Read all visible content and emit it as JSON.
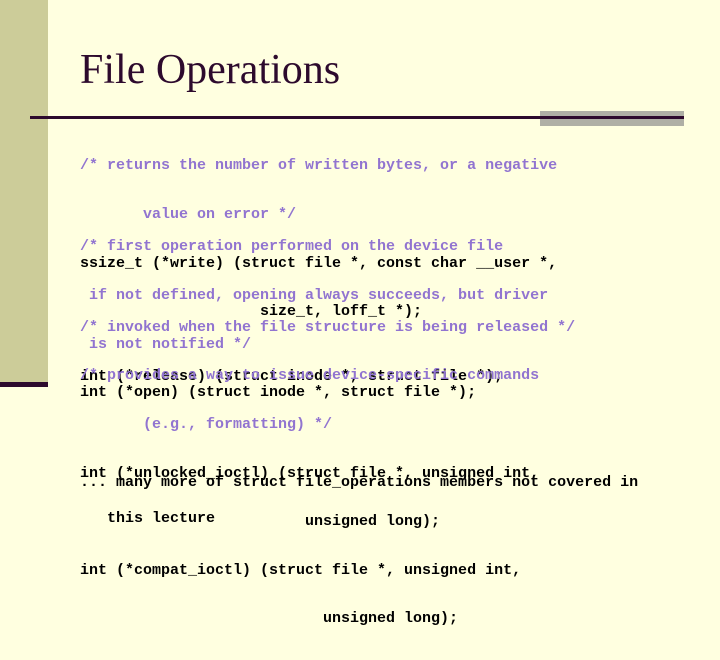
{
  "colors": {
    "background": "#FFFFE0",
    "sidebar": "#CCCC99",
    "accent_dark": "#2D0A2D",
    "rule_gray": "#AFAFA5",
    "comment": "#9174D0",
    "code": "#000000"
  },
  "slide": {
    "title": "File Operations",
    "code_blocks": [
      {
        "lines": [
          {
            "kind": "comment",
            "text": "/* returns the number of written bytes, or a negative"
          },
          {
            "kind": "comment",
            "text": "       value on error */"
          },
          {
            "kind": "code",
            "text": "ssize_t (*write) (struct file *, const char __user *,"
          },
          {
            "kind": "code",
            "text": "                    size_t, loff_t *);"
          }
        ]
      },
      {
        "lines": [
          {
            "kind": "comment",
            "text": "/* first operation performed on the device file"
          },
          {
            "kind": "comment",
            "text": " if not defined, opening always succeeds, but driver"
          },
          {
            "kind": "comment",
            "text": " is not notified */"
          },
          {
            "kind": "code",
            "text": "int (*open) (struct inode *, struct file *);"
          }
        ]
      },
      {
        "lines": [
          {
            "kind": "comment",
            "text": "/* invoked when the file structure is being released */"
          },
          {
            "kind": "code",
            "text": "int (*release) (struct inode *, struct file *);"
          }
        ]
      },
      {
        "lines": [
          {
            "kind": "comment",
            "text": "/* provides a way to issue device-specific commands"
          },
          {
            "kind": "comment",
            "text": "       (e.g., formatting) */"
          },
          {
            "kind": "code",
            "text": "int (*unlocked_ioctl) (struct file *, unsigned int,"
          },
          {
            "kind": "code",
            "text": "                         unsigned long);"
          },
          {
            "kind": "code",
            "text": "int (*compat_ioctl) (struct file *, unsigned int,"
          },
          {
            "kind": "code",
            "text": "                           unsigned long);"
          }
        ]
      },
      {
        "lines": [
          {
            "kind": "code",
            "text": "... many more of struct file_operations members not covered in"
          },
          {
            "kind": "code",
            "text": "   this lecture"
          }
        ]
      }
    ]
  }
}
